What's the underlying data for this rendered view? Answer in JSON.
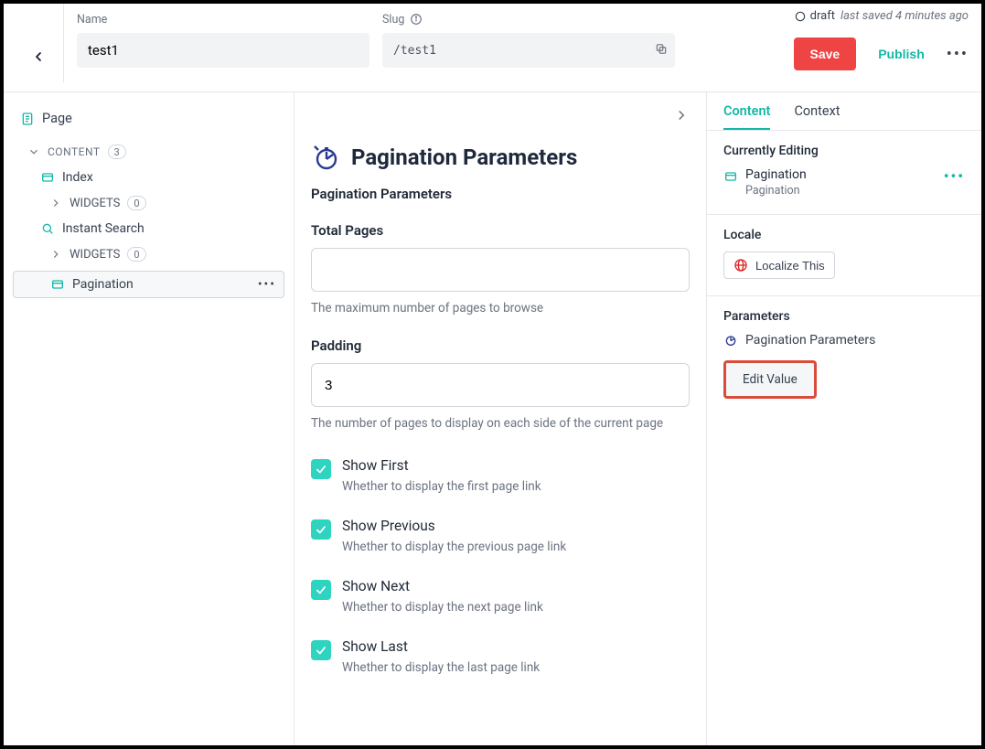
{
  "header": {
    "name_label": "Name",
    "name_value": "test1",
    "slug_label": "Slug",
    "slug_value": "/test1",
    "status": "draft",
    "saved_text": "last saved 4 minutes ago",
    "save_label": "Save",
    "publish_label": "Publish"
  },
  "sidebar": {
    "page_label": "Page",
    "content_label": "CONTENT",
    "content_count": "3",
    "items": [
      {
        "label": "Index",
        "widgets_label": "WIDGETS",
        "widgets_count": "0"
      },
      {
        "label": "Instant Search",
        "widgets_label": "WIDGETS",
        "widgets_count": "0"
      }
    ],
    "selected_label": "Pagination"
  },
  "editor": {
    "title": "Pagination Parameters",
    "subheading": "Pagination Parameters",
    "total_pages": {
      "label": "Total Pages",
      "value": "",
      "hint": "The maximum number of pages to browse"
    },
    "padding": {
      "label": "Padding",
      "value": "3",
      "hint": "The number of pages to display on each side of the current page"
    },
    "checks": [
      {
        "label": "Show First",
        "hint": "Whether to display the first page link"
      },
      {
        "label": "Show Previous",
        "hint": "Whether to display the previous page link"
      },
      {
        "label": "Show Next",
        "hint": "Whether to display the next page link"
      },
      {
        "label": "Show Last",
        "hint": "Whether to display the last page link"
      }
    ]
  },
  "right": {
    "tabs": {
      "content": "Content",
      "context": "Context"
    },
    "currently_editing": {
      "heading": "Currently Editing",
      "label": "Pagination",
      "sublabel": "Pagination"
    },
    "locale": {
      "heading": "Locale",
      "button": "Localize This"
    },
    "parameters": {
      "heading": "Parameters",
      "item": "Pagination Parameters",
      "edit_value": "Edit Value"
    }
  }
}
